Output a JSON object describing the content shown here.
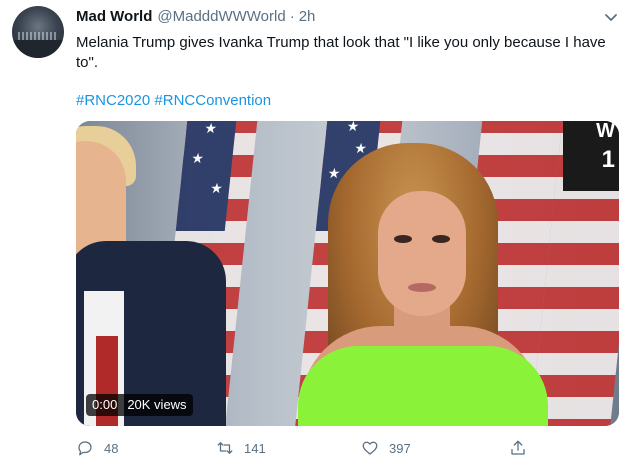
{
  "tweet": {
    "author_name": "Mad World",
    "handle": "@MadddWWWorld",
    "separator": "·",
    "time": "2h",
    "text": "Melania Trump gives Ivanka Trump that look that \"I like you only because I have to\".",
    "hashtags": [
      "#RNC2020",
      "#RNCConvention"
    ],
    "media": {
      "type": "video",
      "time": "0:00",
      "views": "20K views",
      "channel_logo_letter": "W",
      "channel_logo_number": "1"
    },
    "actions": {
      "reply_count": "48",
      "retweet_count": "141",
      "like_count": "397"
    }
  },
  "icons": {
    "reply": "reply-icon",
    "retweet": "retweet-icon",
    "like": "like-icon",
    "share": "share-icon",
    "more": "chevron-down-icon"
  },
  "colors": {
    "link": "#1b95e0",
    "secondary_text": "#5b7083",
    "dress": "#8bf23a"
  }
}
